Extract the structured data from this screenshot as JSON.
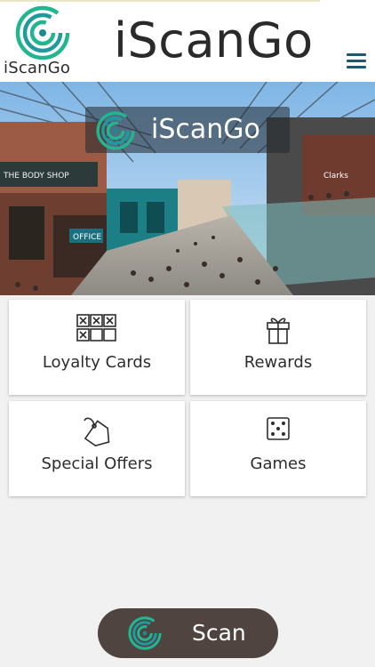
{
  "app": {
    "logo_text": "iScanGo",
    "title": "iScanGo"
  },
  "hero": {
    "badge_text": "iScanGo",
    "shop_sign": "THE BODY SHOP",
    "office_sign": "OFFICE",
    "clarks_sign": "Clarks"
  },
  "tiles": [
    {
      "label": "Loyalty Cards",
      "icon": "loyalty-cards-grid-icon"
    },
    {
      "label": "Rewards",
      "icon": "gift-box-icon"
    },
    {
      "label": "Special Offers",
      "icon": "price-tag-icon"
    },
    {
      "label": "Games",
      "icon": "dice-icon"
    }
  ],
  "scan": {
    "label": "Scan",
    "icon": "iscango-logo-icon"
  },
  "colors": {
    "brand_green": "#20b48c",
    "brand_teal": "#1b8a8f",
    "scan_button_bg": "#4f4440",
    "menu_icon": "#1c5a6e"
  }
}
